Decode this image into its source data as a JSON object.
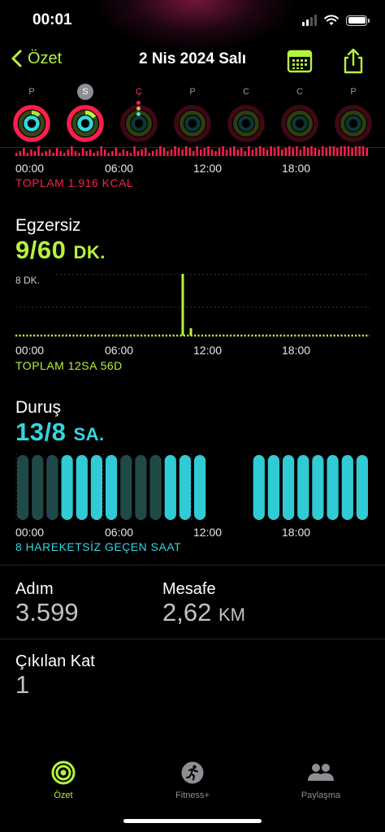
{
  "status_bar": {
    "time": "00:01"
  },
  "nav": {
    "back_label": "Özet",
    "title": "2 Nis 2024 Salı"
  },
  "week": {
    "days": [
      "P",
      "S",
      "Ç",
      "P",
      "C",
      "C",
      "P"
    ]
  },
  "move": {
    "axis_labels": [
      "00:00",
      "06:00",
      "12:00",
      "18:00"
    ],
    "total": "TOPLAM 1.916 KCAL"
  },
  "exercise": {
    "title": "Egzersiz",
    "value": "9/60",
    "unit": "DK.",
    "chart_max_label": "8 DK.",
    "axis_labels": [
      "00:00",
      "06:00",
      "12:00",
      "18:00"
    ],
    "total": "TOPLAM 12SA 56D"
  },
  "stand": {
    "title": "Duruş",
    "value": "13/8",
    "unit": "SA.",
    "axis_labels": [
      "00:00",
      "06:00",
      "12:00",
      "18:00"
    ],
    "note": "8 HAREKETSİZ GEÇEN SAAT",
    "hours": [
      0,
      0,
      0,
      1,
      1,
      1,
      1,
      0,
      0,
      0,
      1,
      1,
      1,
      0,
      0,
      0,
      1,
      1,
      1,
      1,
      1,
      1,
      1,
      1
    ]
  },
  "stats": {
    "steps_label": "Adım",
    "steps_value": "3.599",
    "distance_label": "Mesafe",
    "distance_value": "2,62",
    "distance_unit": "KM",
    "floors_label": "Çıkılan Kat",
    "floors_value": "1"
  },
  "tabbar": {
    "items": [
      "Özet",
      "Fitness+",
      "Paylaşma"
    ]
  },
  "colors": {
    "move": "#fa1e4e",
    "exercise": "#b6f33c",
    "stand": "#33d6e0",
    "accent": "#b6f33c"
  }
}
